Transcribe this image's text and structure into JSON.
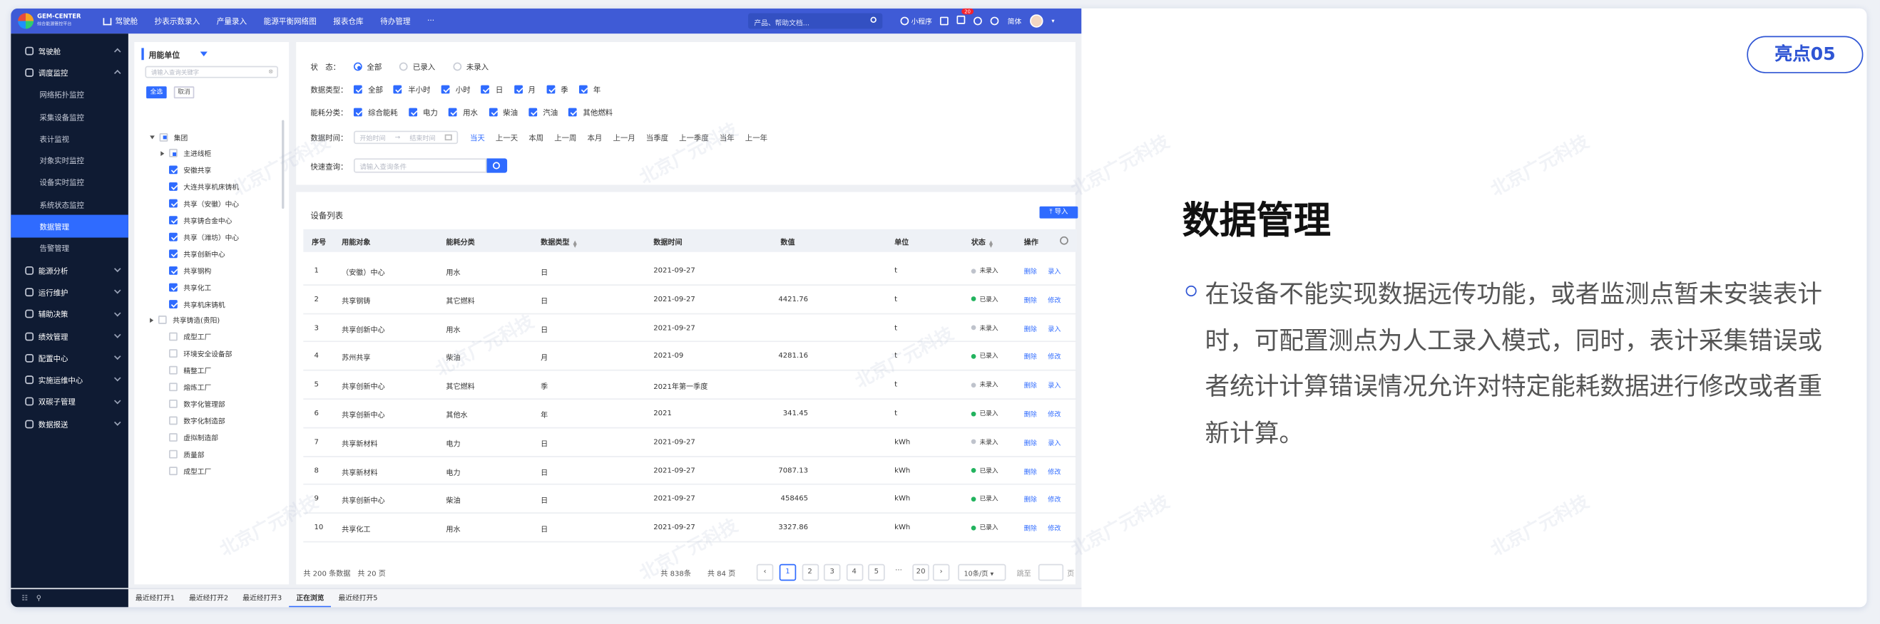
{
  "highlight_tag": "亮点05",
  "description": {
    "title": "数据管理",
    "body": "在设备不能实现数据远传功能，或者监测点暂未安装表计时，可配置测点为人工录入模式，同时，表计采集错误或者统计计算错误情况允许对特定能耗数据进行修改或者重新计算。"
  },
  "watermark": "北京广元科技",
  "topbar": {
    "logo_title": "GEM-CENTER",
    "logo_subtitle": "综合能源管控平台",
    "nav": [
      "驾驶舱",
      "抄表示数录入",
      "产量录入",
      "能源平衡网络图",
      "报表仓库",
      "待办管理",
      "···"
    ],
    "search_placeholder": "产品、帮助文档...",
    "mini_program": "小程序",
    "notif_count": "20",
    "lang": "简体"
  },
  "sidebar": {
    "items": [
      {
        "label": "驾驶舱",
        "level": "top",
        "chev": "up"
      },
      {
        "label": "调度监控",
        "level": "top",
        "chev": "up"
      },
      {
        "label": "网络拓扑监控",
        "level": "sub"
      },
      {
        "label": "采集设备监控",
        "level": "sub"
      },
      {
        "label": "表计监视",
        "level": "sub"
      },
      {
        "label": "对象实时监控",
        "level": "sub"
      },
      {
        "label": "设备实时监控",
        "level": "sub"
      },
      {
        "label": "系统状态监控",
        "level": "sub"
      },
      {
        "label": "数据管理",
        "level": "sub",
        "active": true
      },
      {
        "label": "告警管理",
        "level": "sub"
      },
      {
        "label": "能源分析",
        "level": "top",
        "chev": "down"
      },
      {
        "label": "运行维护",
        "level": "top",
        "chev": "down"
      },
      {
        "label": "辅助决策",
        "level": "top",
        "chev": "down"
      },
      {
        "label": "绩效管理",
        "level": "top",
        "chev": "down"
      },
      {
        "label": "配置中心",
        "level": "top",
        "chev": "down"
      },
      {
        "label": "实施运维中心",
        "level": "top",
        "chev": "down"
      },
      {
        "label": "双碳子管理",
        "level": "top",
        "chev": "down"
      },
      {
        "label": "数据报送",
        "level": "top",
        "chev": "down"
      }
    ]
  },
  "tree": {
    "title": "用能单位",
    "search_placeholder": "请输入查询关键字",
    "btn_all": "全选",
    "btn_invert": "取消",
    "nodes": [
      {
        "label": "集团",
        "indent": 0,
        "caret": "down",
        "check": "half"
      },
      {
        "label": "主进线柜",
        "indent": 1,
        "caret": "right",
        "check": "half"
      },
      {
        "label": "安徽共享",
        "indent": 1,
        "check": "on"
      },
      {
        "label": "大连共享机床铸机",
        "indent": 1,
        "check": "on"
      },
      {
        "label": "共享（安徽）中心",
        "indent": 1,
        "check": "on"
      },
      {
        "label": "共享铸合金中心",
        "indent": 1,
        "check": "on"
      },
      {
        "label": "共享（潍坊）中心",
        "indent": 1,
        "check": "on"
      },
      {
        "label": "共享创新中心",
        "indent": 1,
        "check": "on"
      },
      {
        "label": "共享钢构",
        "indent": 1,
        "check": "on"
      },
      {
        "label": "共享化工",
        "indent": 1,
        "check": "on"
      },
      {
        "label": "共享机床铸机",
        "indent": 1,
        "check": "on"
      },
      {
        "label": "共享铸造(贵阳)",
        "indent": 0,
        "caret": "right",
        "check": "off"
      },
      {
        "label": "成型工厂",
        "indent": 1,
        "check": "off"
      },
      {
        "label": "环境安全设备部",
        "indent": 1,
        "check": "off"
      },
      {
        "label": "精整工厂",
        "indent": 1,
        "check": "off"
      },
      {
        "label": "熔炼工厂",
        "indent": 1,
        "check": "off"
      },
      {
        "label": "数字化管理部",
        "indent": 1,
        "check": "off"
      },
      {
        "label": "数字化制造部",
        "indent": 1,
        "check": "off"
      },
      {
        "label": "虚拟制造部",
        "indent": 1,
        "check": "off"
      },
      {
        "label": "质量部",
        "indent": 1,
        "check": "off"
      },
      {
        "label": "成型工厂",
        "indent": 1,
        "check": "off"
      }
    ]
  },
  "filter": {
    "status_label": "状　态：",
    "status_options": [
      {
        "label": "全部",
        "on": true
      },
      {
        "label": "已录入",
        "on": false
      },
      {
        "label": "未录入",
        "on": false
      }
    ],
    "datatype_label": "数据类型：",
    "datatype_options": [
      "全部",
      "半小时",
      "小时",
      "日",
      "月",
      "季",
      "年"
    ],
    "energy_label": "能耗分类：",
    "energy_options": [
      "综合能耗",
      "电力",
      "用水",
      "柴油",
      "汽油",
      "其他燃料"
    ],
    "time_label": "数据时间：",
    "time_start": "开始时间",
    "time_sep": "→",
    "time_end": "结束时间",
    "time_presets": [
      "当天",
      "上一天",
      "本周",
      "上一周",
      "本月",
      "上一月",
      "当季度",
      "上一季度",
      "当年",
      "上一年"
    ],
    "quick_label": "快速查询：",
    "quick_placeholder": "请输入查询条件"
  },
  "table": {
    "title": "设备列表",
    "import_label": "导入",
    "headers": {
      "seq": "序号",
      "obj": "用能对象",
      "cat": "能耗分类",
      "type": "数据类型",
      "time": "数据时间",
      "value": "数值",
      "unit": "单位",
      "status": "状态",
      "op": "操作"
    },
    "rows": [
      {
        "seq": "1",
        "obj": "（安徽）中心",
        "cat": "用水",
        "type": "日",
        "time": "2021-09-27",
        "value": "",
        "unit": "t",
        "status": "未录入",
        "done": false
      },
      {
        "seq": "2",
        "obj": "共享钢铸",
        "cat": "其它燃料",
        "type": "日",
        "time": "2021-09-27",
        "value": "4421.76",
        "unit": "t",
        "status": "已录入",
        "done": true
      },
      {
        "seq": "3",
        "obj": "共享创新中心",
        "cat": "用水",
        "type": "日",
        "time": "2021-09-27",
        "value": "",
        "unit": "t",
        "status": "未录入",
        "done": false
      },
      {
        "seq": "4",
        "obj": "苏州共享",
        "cat": "柴油",
        "type": "月",
        "time": "2021-09",
        "value": "4281.16",
        "unit": "t",
        "status": "已录入",
        "done": true
      },
      {
        "seq": "5",
        "obj": "共享创新中心",
        "cat": "其它燃料",
        "type": "季",
        "time": "2021年第一季度",
        "value": "",
        "unit": "t",
        "status": "未录入",
        "done": false
      },
      {
        "seq": "6",
        "obj": "共享创新中心",
        "cat": "其他水",
        "type": "年",
        "time": "2021",
        "value": "341.45",
        "unit": "t",
        "status": "已录入",
        "done": true
      },
      {
        "seq": "7",
        "obj": "共享新材料",
        "cat": "电力",
        "type": "日",
        "time": "2021-09-27",
        "value": "",
        "unit": "kWh",
        "status": "未录入",
        "done": false
      },
      {
        "seq": "8",
        "obj": "共享新材料",
        "cat": "电力",
        "type": "日",
        "time": "2021-09-27",
        "value": "7087.13",
        "unit": "kWh",
        "status": "已录入",
        "done": true
      },
      {
        "seq": "9",
        "obj": "共享创新中心",
        "cat": "柴油",
        "type": "日",
        "time": "2021-09-27",
        "value": "458465",
        "unit": "kWh",
        "status": "已录入",
        "done": true
      },
      {
        "seq": "10",
        "obj": "共享化工",
        "cat": "用水",
        "type": "日",
        "time": "2021-09-27",
        "value": "3327.86",
        "unit": "kWh",
        "status": "已录入",
        "done": true
      }
    ],
    "op_delete": "删除",
    "op_enter": "录入",
    "op_edit": "修改",
    "pager": {
      "total_left": "共 200 条数据　共 20 页",
      "total_right": "共 838条",
      "pages_count": "共 84 页",
      "pages": [
        "1",
        "2",
        "3",
        "4",
        "5",
        "···",
        "20"
      ],
      "prev": "‹",
      "next": "›",
      "size": "10条/页",
      "goto": "跳至",
      "page_unit": "页"
    }
  },
  "bottom_tabs": [
    {
      "label": "最近经打开1",
      "current": false
    },
    {
      "label": "最近经打开2",
      "current": false
    },
    {
      "label": "最近经打开3",
      "current": false
    },
    {
      "label": "正在浏览",
      "current": true
    },
    {
      "label": "最近经打开5",
      "current": false
    }
  ],
  "colors": {
    "brand_blue": "#3f5bd6",
    "accent": "#2f6bff",
    "sidebar_bg": "#0f1b33",
    "ok_green": "#22b35e",
    "pending_gray": "#bfc3cc"
  }
}
